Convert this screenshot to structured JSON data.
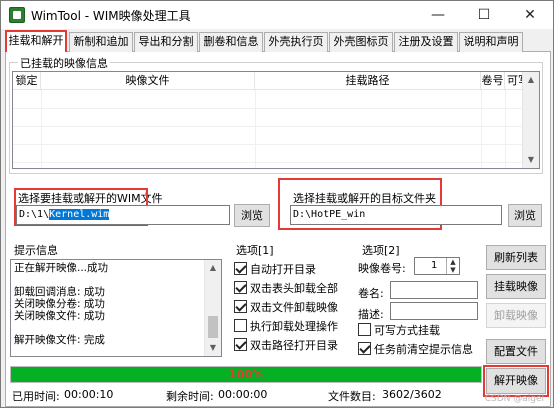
{
  "window": {
    "title": "WimTool - WIM映像处理工具",
    "minimize": "—",
    "maximize": "☐",
    "close": "✕"
  },
  "tabs": [
    {
      "label": "挂载和解开"
    },
    {
      "label": "新制和追加"
    },
    {
      "label": "导出和分割"
    },
    {
      "label": "删卷和信息"
    },
    {
      "label": "外壳执行页"
    },
    {
      "label": "外壳图标页"
    },
    {
      "label": "注册及设置"
    },
    {
      "label": "说明和声明"
    }
  ],
  "mounted": {
    "legend": "已挂载的映像信息",
    "columns": [
      "锁定",
      "映像文件",
      "挂载路径",
      "卷号",
      "可写"
    ]
  },
  "wim_file": {
    "label": "选择要挂载或解开的WIM文件",
    "value_prefix": "D:\\1\\",
    "value_selected": "Kernel.wim",
    "browse": "浏览"
  },
  "target_folder": {
    "label": "选择挂载或解开的目标文件夹",
    "value": "D:\\HotPE_win",
    "browse": "浏览"
  },
  "info": {
    "legend": "提示信息",
    "lines": [
      "正在解开映像...成功",
      "",
      "卸载回调消息: 成功",
      "关闭映像分卷: 成功",
      "关闭映像文件: 成功",
      "",
      "解开映像文件: 完成"
    ]
  },
  "options1": {
    "legend": "选项[1]",
    "items": [
      {
        "label": "自动打开目录",
        "checked": true
      },
      {
        "label": "双击表头卸载全部",
        "checked": true
      },
      {
        "label": "双击文件卸载映像",
        "checked": true
      },
      {
        "label": "执行卸载处理操作",
        "checked": false
      },
      {
        "label": "双击路径打开目录",
        "checked": true
      }
    ]
  },
  "options2": {
    "legend": "选项[2]",
    "volume_label": "映像卷号:",
    "volume_value": "1",
    "name_label": "卷名:",
    "desc_label": "描述:",
    "writable_label": "可写方式挂载",
    "writable_checked": false,
    "clear_label": "任务前清空提示信息",
    "clear_checked": true
  },
  "buttons": {
    "refresh": "刷新列表",
    "mount": "挂载映像",
    "unmount": "卸载映像",
    "config": "配置文件",
    "extract": "解开映像"
  },
  "progress": {
    "percent": 100,
    "text": "100%"
  },
  "status": {
    "elapsed_label": "已用时间:",
    "elapsed": "00:00:10",
    "remaining_label": "剩余时间:",
    "remaining": "00:00:00",
    "count_label": "文件数目:",
    "count": "3602/3602"
  },
  "watermark": "CSDN @aigel",
  "colors": {
    "accent_red": "#e53935",
    "progress_green": "#06b025",
    "selection": "#0078d7"
  }
}
